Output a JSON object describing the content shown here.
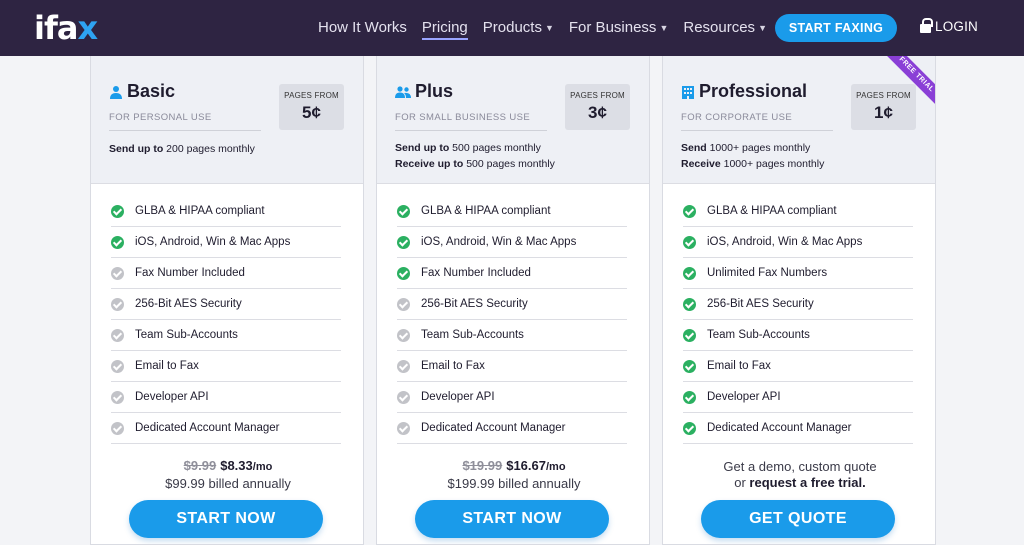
{
  "nav": {
    "logo_main": "ifa",
    "logo_x": "x",
    "links": [
      "How It Works",
      "Pricing",
      "Products",
      "For Business",
      "Resources"
    ],
    "start_button": "START FAXING",
    "login": "LOGIN"
  },
  "colors": {
    "nav_bg": "#2e2442",
    "accent_blue": "#1a9bea",
    "check_green": "#2bb061",
    "check_gray": "#c2c3c8",
    "ribbon_purple": "#8a3fd6"
  },
  "plans": [
    {
      "name": "Basic",
      "icon": "user-icon",
      "subtitle": "FOR PERSONAL USE",
      "price_label": "PAGES FROM",
      "price_value": "5¢",
      "send_bold": "Send up to",
      "send_rest": " 200 pages monthly",
      "receive_bold": "",
      "receive_rest": "",
      "features": [
        {
          "label": "GLBA & HIPAA compliant",
          "included": true
        },
        {
          "label": "iOS, Android, Win & Mac Apps",
          "included": true
        },
        {
          "label": "Fax Number Included",
          "included": false
        },
        {
          "label": "256-Bit AES Security",
          "included": false
        },
        {
          "label": "Team Sub-Accounts",
          "included": false
        },
        {
          "label": "Email to Fax",
          "included": false
        },
        {
          "label": "Developer API",
          "included": false
        },
        {
          "label": "Dedicated Account Manager",
          "included": false
        }
      ],
      "old_price": "$9.99",
      "new_price": "$8.33",
      "per": "/mo",
      "billed": "$99.99 billed annually",
      "cta": "START NOW"
    },
    {
      "name": "Plus",
      "icon": "users-icon",
      "subtitle": "FOR SMALL BUSINESS USE",
      "price_label": "PAGES FROM",
      "price_value": "3¢",
      "send_bold": "Send up to",
      "send_rest": " 500 pages monthly",
      "receive_bold": "Receive up to",
      "receive_rest": " 500 pages monthly",
      "features": [
        {
          "label": "GLBA & HIPAA compliant",
          "included": true
        },
        {
          "label": "iOS, Android, Win & Mac Apps",
          "included": true
        },
        {
          "label": "Fax Number Included",
          "included": true
        },
        {
          "label": "256-Bit AES Security",
          "included": false
        },
        {
          "label": "Team Sub-Accounts",
          "included": false
        },
        {
          "label": "Email to Fax",
          "included": false
        },
        {
          "label": "Developer API",
          "included": false
        },
        {
          "label": "Dedicated Account Manager",
          "included": false
        }
      ],
      "old_price": "$19.99",
      "new_price": "$16.67",
      "per": "/mo",
      "billed": "$199.99 billed annually",
      "cta": "START NOW"
    },
    {
      "name": "Professional",
      "icon": "building-icon",
      "subtitle": "FOR CORPORATE USE",
      "price_label": "PAGES FROM",
      "price_value": "1¢",
      "send_bold": "Send",
      "send_rest": " 1000+ pages monthly",
      "receive_bold": "Receive",
      "receive_rest": " 1000+ pages monthly",
      "ribbon": "FREE TRIAL",
      "features": [
        {
          "label": "GLBA & HIPAA compliant",
          "included": true
        },
        {
          "label": "iOS, Android, Win & Mac Apps",
          "included": true
        },
        {
          "label": "Unlimited Fax Numbers",
          "included": true
        },
        {
          "label": "256-Bit AES Security",
          "included": true
        },
        {
          "label": "Team Sub-Accounts",
          "included": true
        },
        {
          "label": "Email to Fax",
          "included": true
        },
        {
          "label": "Developer API",
          "included": true
        },
        {
          "label": "Dedicated Account Manager",
          "included": true
        }
      ],
      "quote_line1": "Get a demo, custom quote",
      "quote_line2_pre": "or ",
      "quote_line2_bold": "request a free trial.",
      "cta": "GET QUOTE"
    }
  ]
}
